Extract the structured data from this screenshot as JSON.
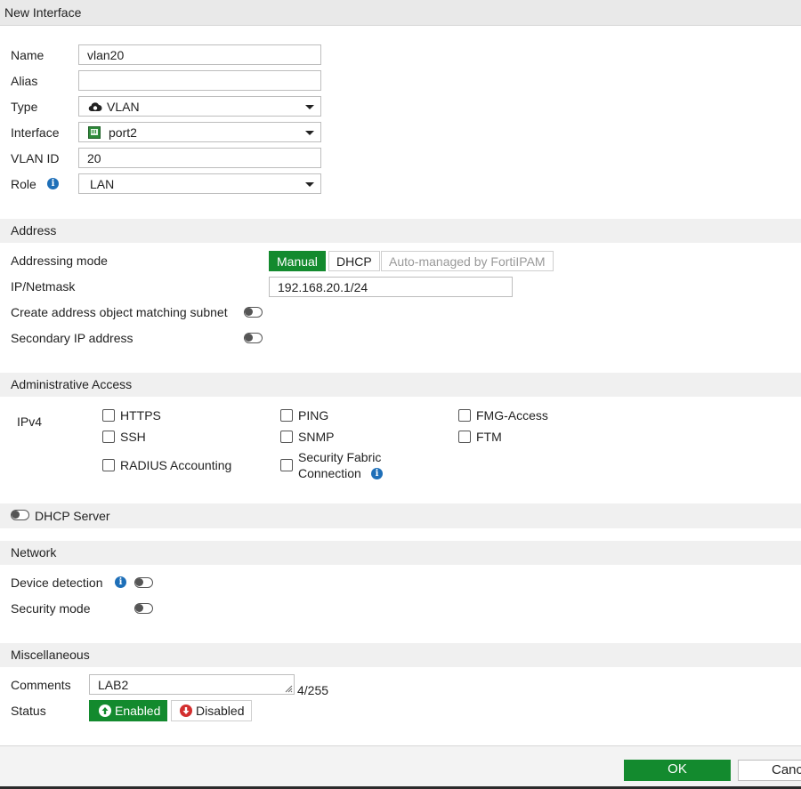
{
  "window": {
    "title": "New Interface"
  },
  "form": {
    "name_label": "Name",
    "name_value": "vlan20",
    "alias_label": "Alias",
    "alias_value": "",
    "type_label": "Type",
    "type_value": "VLAN",
    "interface_label": "Interface",
    "interface_value": "port2",
    "vlanid_label": "VLAN ID",
    "vlanid_value": "20",
    "role_label": "Role",
    "role_value": "LAN"
  },
  "address": {
    "section_title": "Address",
    "mode_label": "Addressing mode",
    "modes": [
      "Manual",
      "DHCP",
      "Auto-managed by FortiIPAM"
    ],
    "selected_mode": "Manual",
    "ip_label": "IP/Netmask",
    "ip_value": "192.168.20.1/24",
    "create_obj_label": "Create address object matching subnet",
    "secondary_label": "Secondary IP address"
  },
  "admin": {
    "section_title": "Administrative Access",
    "ipv4_label": "IPv4",
    "options": [
      "HTTPS",
      "PING",
      "FMG-Access",
      "SSH",
      "SNMP",
      "FTM",
      "RADIUS Accounting",
      "Security Fabric",
      "Connection"
    ]
  },
  "dhcp": {
    "label": "DHCP Server"
  },
  "network": {
    "section_title": "Network",
    "device_detection_label": "Device detection",
    "security_mode_label": "Security mode"
  },
  "misc": {
    "section_title": "Miscellaneous",
    "comments_label": "Comments",
    "comments_value": "LAB2",
    "comments_count": "4/255",
    "status_label": "Status",
    "enabled_label": "Enabled",
    "disabled_label": "Disabled"
  },
  "footer": {
    "ok_label": "OK",
    "cancel_label": "Canc"
  },
  "colors": {
    "accent_green": "#138a2e",
    "info_blue": "#1e6fb8",
    "disabled_red": "#d32f2f"
  },
  "icons": [
    "cloud-icon",
    "port-icon",
    "info-icon",
    "arrow-up-icon",
    "arrow-down-icon",
    "caret-down-icon"
  ]
}
